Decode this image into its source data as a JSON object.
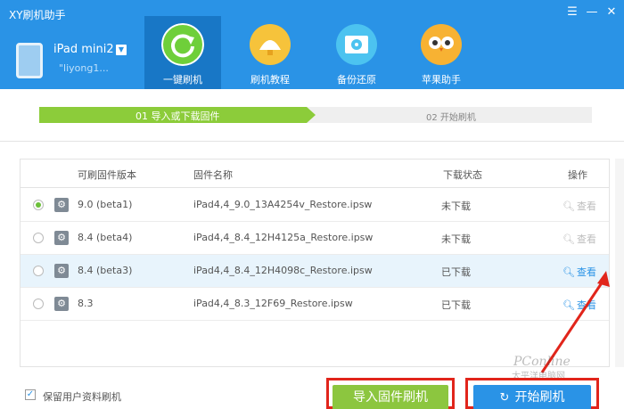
{
  "app": {
    "title": "XY刷机助手"
  },
  "window_controls": {
    "menu": "☰",
    "minimize": "—",
    "close": "✕"
  },
  "device": {
    "name": "iPad mini2",
    "dropdown": "▼",
    "user": "\"liyong1..."
  },
  "nav": [
    {
      "label": "一键刷机",
      "icon": "refresh-icon",
      "active": true
    },
    {
      "label": "刷机教程",
      "icon": "lamp-icon",
      "active": false
    },
    {
      "label": "备份还原",
      "icon": "disc-icon",
      "active": false
    },
    {
      "label": "苹果助手",
      "icon": "owl-icon",
      "active": false
    }
  ],
  "steps": {
    "step1": "01  导入或下载固件",
    "step2": "02  开始刷机"
  },
  "table": {
    "headers": [
      "可刷固件版本",
      "固件名称",
      "下载状态",
      "操作"
    ],
    "rows": [
      {
        "version": "9.0 (beta1)",
        "file": "iPad4,4_9.0_13A4254v_Restore.ipsw",
        "status": "未下载",
        "action": "查看",
        "selected": true,
        "action_enabled": false
      },
      {
        "version": "8.4 (beta4)",
        "file": "iPad4,4_8.4_12H4125a_Restore.ipsw",
        "status": "未下载",
        "action": "查看",
        "selected": false,
        "action_enabled": false
      },
      {
        "version": "8.4 (beta3)",
        "file": "iPad4,4_8.4_12H4098c_Restore.ipsw",
        "status": "已下载",
        "action": "查看",
        "selected": false,
        "action_enabled": true
      },
      {
        "version": "8.3",
        "file": "iPad4,4_8.3_12F69_Restore.ipsw",
        "status": "已下载",
        "action": "查看",
        "selected": false,
        "action_enabled": true
      }
    ]
  },
  "footer": {
    "keep_label": "保留用户资料刷机",
    "keep_checked": "✓",
    "import_button": "导入固件刷机",
    "start_button": "开始刷机",
    "start_icon": "↻"
  },
  "watermark": {
    "line1": "PConline",
    "line2": "太平洋电脑网"
  },
  "colors": {
    "header": "#2a93e6",
    "nav_active": "#1877c6",
    "step_active": "#8ccc3a",
    "import_button": "#8cc63f",
    "start_button": "#2a93e6",
    "highlight_border": "#e1251b"
  }
}
